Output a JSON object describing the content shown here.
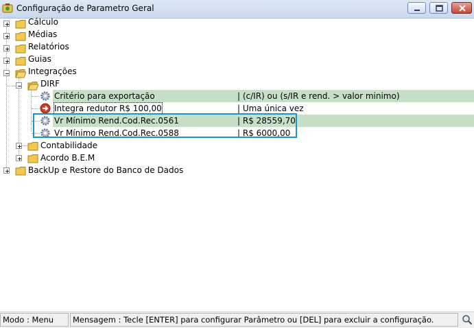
{
  "window": {
    "title": "Configuração de Parametro Geral"
  },
  "tree": {
    "calculo": "Cálculo",
    "medias": "Médias",
    "relatorios": "Relatórios",
    "guias": "Guias",
    "integracoes": "Integrações",
    "dirf": "DIRF",
    "dirf_items": [
      {
        "label": "Critério para exportação",
        "value": "| (c/IR)  ou  (s/IR e rend. > valor minimo)"
      },
      {
        "label": "Integra redutor R$ 100,00",
        "value": "| Uma única vez"
      },
      {
        "label": "Vr Mínimo Rend.Cod.Rec.0561",
        "value": "| R$ 28559,70"
      },
      {
        "label": "Vr Mínimo Rend.Cod.Rec.0588",
        "value": "| R$ 6000,00"
      }
    ],
    "contabilidade": "Contabilidade",
    "acordo": "Acordo B.E.M",
    "backup": "BackUp e Restore do Banco de Dados"
  },
  "status": {
    "modo": "Modo : Menu",
    "mensagem": "Mensagem : Tecle [ENTER] para configurar Parâmetro ou [DEL] para excluir a configuração."
  },
  "colors": {
    "highlight": "#c6e0c7",
    "selection_border": "#1a95c9",
    "folder": "#f2c94c"
  }
}
